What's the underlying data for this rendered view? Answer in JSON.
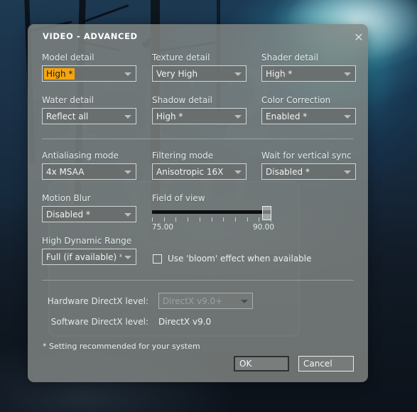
{
  "dialog": {
    "title": "VIDEO - ADVANCED",
    "close_icon": "close-icon",
    "footnote": "* Setting recommended for your system"
  },
  "fields": {
    "model_detail": {
      "label": "Model detail",
      "value": "High *",
      "highlighted": true
    },
    "texture_detail": {
      "label": "Texture detail",
      "value": "Very High"
    },
    "shader_detail": {
      "label": "Shader detail",
      "value": "High *"
    },
    "water_detail": {
      "label": "Water detail",
      "value": "Reflect all"
    },
    "shadow_detail": {
      "label": "Shadow detail",
      "value": "High *"
    },
    "color_correction": {
      "label": "Color Correction",
      "value": "Enabled *"
    },
    "antialiasing": {
      "label": "Antialiasing mode",
      "value": "4x MSAA"
    },
    "filtering": {
      "label": "Filtering mode",
      "value": "Anisotropic 16X"
    },
    "vsync": {
      "label": "Wait for vertical sync",
      "value": "Disabled *"
    },
    "motion_blur": {
      "label": "Motion Blur",
      "value": "Disabled *"
    },
    "hdr": {
      "label": "High Dynamic Range",
      "value": "Full (if available) *"
    }
  },
  "field_of_view": {
    "label": "Field of view",
    "min_label": "75.00",
    "max_label": "90.00",
    "min": 75.0,
    "max": 90.0,
    "value": 90.0,
    "tick_count": 11
  },
  "bloom": {
    "label": "Use 'bloom' effect when available",
    "checked": false
  },
  "directx": {
    "hardware_label": "Hardware DirectX level:",
    "hardware_value": "DirectX v9.0+",
    "hardware_disabled": true,
    "software_label": "Software DirectX level:",
    "software_value": "DirectX v9.0"
  },
  "buttons": {
    "ok": "OK",
    "cancel": "Cancel"
  },
  "colors": {
    "highlight": "#f5a50d",
    "panel": "#808482",
    "text": "#eaeeef"
  }
}
